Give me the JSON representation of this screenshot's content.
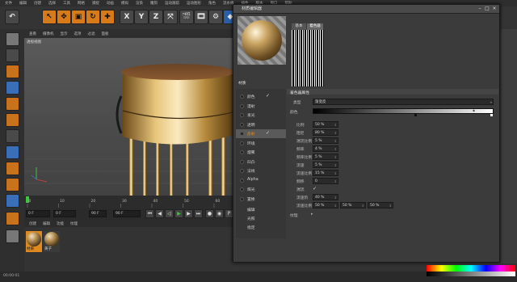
{
  "menubar": [
    "文件",
    "编辑",
    "创建",
    "选择",
    "工具",
    "网格",
    "捕捉",
    "动画",
    "模拟",
    "渲染",
    "雕刻",
    "运动跟踪",
    "运动图形",
    "角色",
    "流水线",
    "插件",
    "脚本",
    "窗口",
    "帮助"
  ],
  "toolbar": {
    "undo_icon": "undo-icon",
    "axes": [
      "X",
      "Y",
      "Z"
    ]
  },
  "viewport": {
    "menu": [
      "查看",
      "摄像机",
      "显示",
      "选项",
      "过滤",
      "面板"
    ],
    "label": "透视视图"
  },
  "timeline": {
    "ticks": [
      "0",
      "10",
      "20",
      "30",
      "40",
      "50",
      "60",
      "70",
      "80"
    ],
    "frame_start": "0 F",
    "frame_current": "0 F",
    "frame_end": "90 F",
    "frame_end2": "90 F"
  },
  "material_manager": {
    "menu": [
      "创建",
      "编辑",
      "功能",
      "纹理"
    ],
    "materials": [
      {
        "label": "材质"
      },
      {
        "label": "黄子"
      }
    ]
  },
  "attr_panel": {
    "rows": [
      "坐标",
      "对象",
      "平滑着色(Phong)"
    ]
  },
  "dialog": {
    "title": "材质编辑器",
    "tabs": [
      "基本",
      "着色器"
    ],
    "material_name": "材质",
    "channels": [
      {
        "label": "颜色",
        "checked": true
      },
      {
        "label": "漫射",
        "checked": false
      },
      {
        "label": "发光",
        "checked": false
      },
      {
        "label": "透明",
        "checked": false
      },
      {
        "label": "反射",
        "checked": true,
        "selected": true
      },
      {
        "label": "环境",
        "checked": false
      },
      {
        "label": "烟雾",
        "checked": false
      },
      {
        "label": "凹凸",
        "checked": false
      },
      {
        "label": "法线",
        "checked": false
      },
      {
        "label": "Alpha",
        "checked": false
      },
      {
        "label": "辉光",
        "checked": false
      },
      {
        "label": "置换",
        "checked": false
      }
    ],
    "extra_items": [
      "编辑",
      "光照",
      "指定"
    ],
    "section_title": "着色器属性",
    "type_label": "类型",
    "type_value": "渐变反",
    "gradient_label": "颜色",
    "params": [
      {
        "label": "比例",
        "value": "50 %"
      },
      {
        "label": "阻尼",
        "value": "80 %"
      },
      {
        "label": "湍流比例",
        "value": "5 %"
      },
      {
        "label": "频率",
        "value": "4 %"
      },
      {
        "label": "频率比例",
        "value": "5 %"
      },
      {
        "label": "流速",
        "value": "5 %"
      },
      {
        "label": "流速比例",
        "value": "15 %"
      },
      {
        "label": "频移",
        "value": "0"
      },
      {
        "label": "湍流",
        "value": ""
      },
      {
        "label": "流速阶",
        "value": "40 %"
      },
      {
        "label": "流速比例",
        "values": [
          "50 %",
          "50 %",
          "50 %"
        ]
      }
    ],
    "bottom_label": "纹理"
  },
  "statusbar": {
    "text": "00:00:01"
  },
  "colors": {
    "accent_orange": "#d67a1a",
    "selected_label": "#e08a1e",
    "timeline_green": "#3cc83c"
  }
}
